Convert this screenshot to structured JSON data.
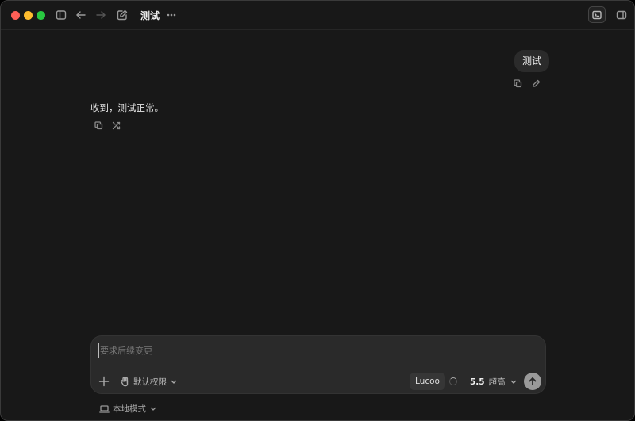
{
  "window": {
    "title": "测试"
  },
  "messages": {
    "user": "测试",
    "assistant": "收到，测试正常。"
  },
  "composer": {
    "placeholder": "要求后续变更",
    "permission_label": "默认权限",
    "model_label": "Lucoo",
    "version": "5.5",
    "reasoning_level": "超高"
  },
  "footer": {
    "mode_label": "本地模式"
  },
  "colors": {
    "close": "#fe5f57",
    "minimize": "#febc2e",
    "zoom": "#28c840",
    "background": "#181818",
    "bubble": "#2b2b2b"
  },
  "icons": {
    "titlebar_left": [
      "sidebar-toggle-icon",
      "back-arrow-icon",
      "forward-arrow-icon",
      "compose-icon",
      "more-icon"
    ],
    "titlebar_right": [
      "terminal-icon",
      "right-panel-icon"
    ],
    "user_message_actions": [
      "copy-icon",
      "edit-icon"
    ],
    "assistant_message_actions": [
      "copy-icon",
      "branch-icon"
    ],
    "composer": [
      "plus-icon",
      "hand-icon",
      "chevron-down-icon",
      "send-arrow-icon"
    ],
    "footer": [
      "laptop-icon",
      "chevron-down-icon"
    ]
  }
}
